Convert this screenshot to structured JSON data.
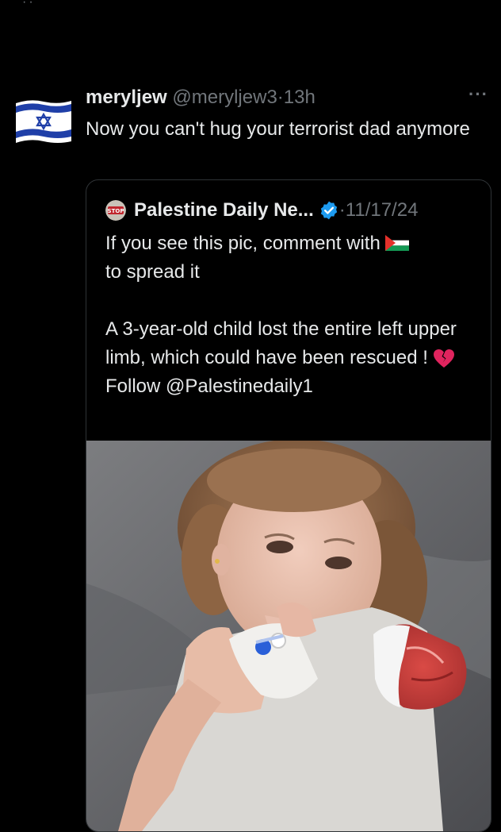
{
  "top": {
    "dots": "··"
  },
  "tweet": {
    "display_name": "meryljew",
    "handle": "@meryljew3",
    "separator": "·",
    "time": "13h",
    "more": "···",
    "text": "Now you can't hug your terrorist dad anymore",
    "avatar_icon": "israel-flag-icon"
  },
  "quote": {
    "display_name": "Palestine Daily Ne...",
    "separator": "·",
    "date": "11/17/24",
    "avatar_text": "STOP",
    "line1_before_flag": "If you see this pic, comment with",
    "line1_flag_icon": "palestine-flag-icon",
    "line2": "to spread it",
    "paragraph2": "A 3-year-old child lost the entire left upper limb, which could have been rescued !",
    "heart_icon": "broken-heart-icon",
    "follow": "Follow @Palestinedaily1",
    "photo_icon": "photo-child-icon"
  },
  "colors": {
    "background": "#000000",
    "text": "#e7e9ea",
    "muted": "#71767b",
    "border": "#2f3336",
    "verified": "#1d9bf0"
  }
}
